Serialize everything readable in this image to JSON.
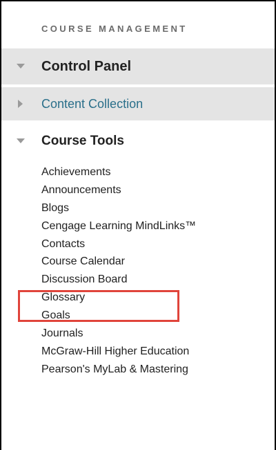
{
  "panel": {
    "header": "COURSE MANAGEMENT",
    "sections": {
      "control_panel": {
        "label": "Control Panel",
        "state": "expanded"
      },
      "content_collection": {
        "label": "Content Collection",
        "state": "collapsed"
      },
      "course_tools": {
        "label": "Course Tools",
        "state": "expanded"
      }
    },
    "tools": [
      "Achievements",
      "Announcements",
      "Blogs",
      "Cengage Learning MindLinks™",
      "Contacts",
      "Course Calendar",
      "Discussion Board",
      "Glossary",
      "Goals",
      "Journals",
      "McGraw-Hill Higher Education",
      "Pearson's MyLab & Mastering"
    ]
  },
  "highlight": {
    "target": "Discussion Board",
    "color": "#e0443b"
  },
  "colors": {
    "section_background": "#e4e4e4",
    "link_color": "#2a6f8a",
    "header_color": "#6b6b6b"
  }
}
